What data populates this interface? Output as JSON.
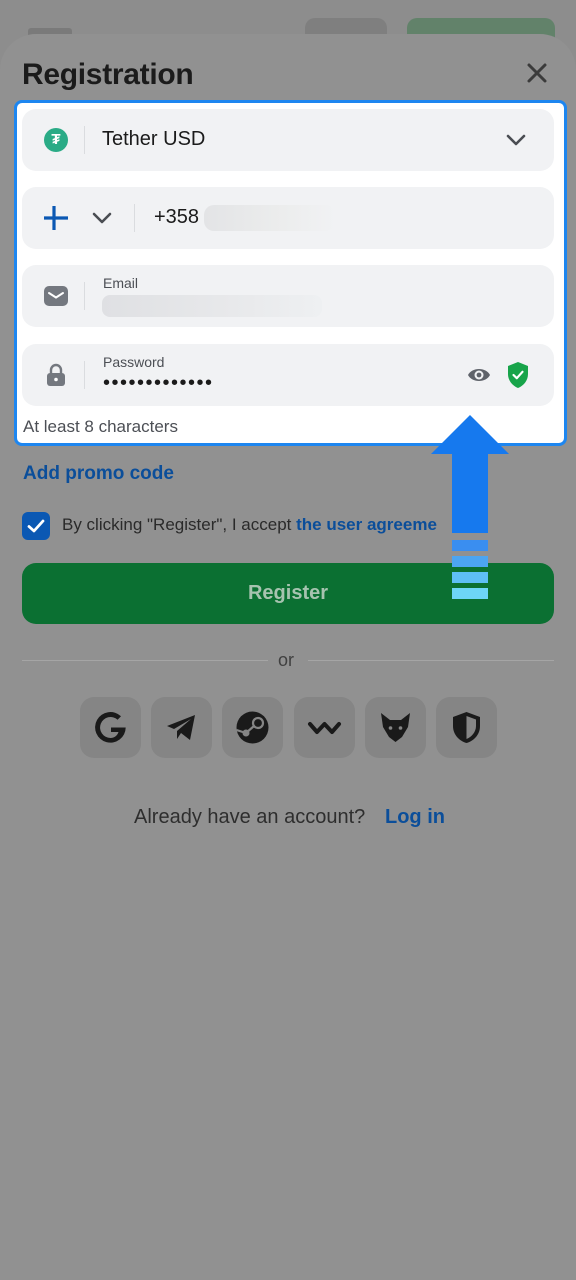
{
  "sheet": {
    "title": "Registration"
  },
  "form": {
    "currency": {
      "value": "Tether USD",
      "icon": "tether-icon"
    },
    "phone": {
      "value": "+358",
      "icon": "finland-flag-icon"
    },
    "email": {
      "label": "Email",
      "icon": "mail-icon"
    },
    "password": {
      "label": "Password",
      "value": "•••••••••••••",
      "icon": "lock-icon"
    },
    "hint": "At least 8 characters"
  },
  "promo": {
    "label": "Add promo code"
  },
  "agreement": {
    "text": "By clicking \"Register\", I accept ",
    "link": "the user agreeme",
    "checked": true
  },
  "register": {
    "label": "Register"
  },
  "divider": {
    "text": "or"
  },
  "social": [
    {
      "name": "google",
      "icon": "google-icon"
    },
    {
      "name": "telegram",
      "icon": "telegram-icon"
    },
    {
      "name": "steam",
      "icon": "steam-icon"
    },
    {
      "name": "walletconnect",
      "icon": "walletconnect-icon"
    },
    {
      "name": "metamask",
      "icon": "fox-icon"
    },
    {
      "name": "shield",
      "icon": "shield-icon"
    }
  ],
  "footer": {
    "text": "Already have an account?",
    "login": "Log in"
  },
  "colors": {
    "accent": "#0b4e9a",
    "register_bg": "#0b7032",
    "highlight_border": "#1d86f0"
  }
}
